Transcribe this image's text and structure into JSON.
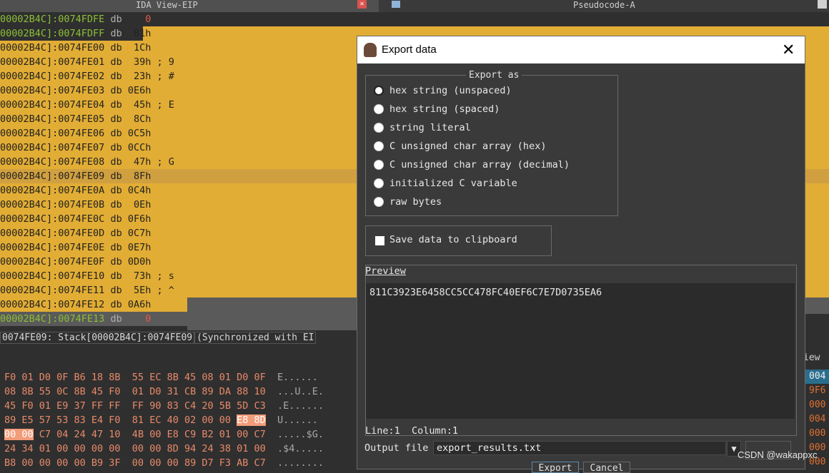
{
  "tabs": {
    "ida_view": "IDA View-EIP",
    "pseudocode": "Pseudocode-A"
  },
  "disasm": [
    {
      "addr": "00002B4C]:0074FDFE",
      "op": "db",
      "val": "   0",
      "cmt": "",
      "style": "dim"
    },
    {
      "addr": "00002B4C]:0074FDFF",
      "op": "db",
      "val": " 81h",
      "cmt": "",
      "style": "start"
    },
    {
      "addr": "00002B4C]:0074FE00",
      "op": "db",
      "val": " 1Ch",
      "cmt": "",
      "style": "sel"
    },
    {
      "addr": "00002B4C]:0074FE01",
      "op": "db",
      "val": " 39h",
      "cmt": " ; 9",
      "style": "sel"
    },
    {
      "addr": "00002B4C]:0074FE02",
      "op": "db",
      "val": " 23h",
      "cmt": " ; #",
      "style": "sel"
    },
    {
      "addr": "00002B4C]:0074FE03",
      "op": "db",
      "val": "0E6h",
      "cmt": "",
      "style": "sel"
    },
    {
      "addr": "00002B4C]:0074FE04",
      "op": "db",
      "val": " 45h",
      "cmt": " ; E",
      "style": "sel"
    },
    {
      "addr": "00002B4C]:0074FE05",
      "op": "db",
      "val": " 8Ch",
      "cmt": "",
      "style": "sel"
    },
    {
      "addr": "00002B4C]:0074FE06",
      "op": "db",
      "val": "0C5h",
      "cmt": "",
      "style": "sel"
    },
    {
      "addr": "00002B4C]:0074FE07",
      "op": "db",
      "val": "0CCh",
      "cmt": "",
      "style": "sel"
    },
    {
      "addr": "00002B4C]:0074FE08",
      "op": "db",
      "val": " 47h",
      "cmt": " ; G",
      "style": "sel"
    },
    {
      "addr": "00002B4C]:0074FE09",
      "op": "db",
      "val": " 8Fh",
      "cmt": "",
      "style": "cur"
    },
    {
      "addr": "00002B4C]:0074FE0A",
      "op": "db",
      "val": "0C4h",
      "cmt": "",
      "style": "sel"
    },
    {
      "addr": "00002B4C]:0074FE0B",
      "op": "db",
      "val": " 0Eh",
      "cmt": "",
      "style": "sel"
    },
    {
      "addr": "00002B4C]:0074FE0C",
      "op": "db",
      "val": "0F6h",
      "cmt": "",
      "style": "sel"
    },
    {
      "addr": "00002B4C]:0074FE0D",
      "op": "db",
      "val": "0C7h",
      "cmt": "",
      "style": "sel"
    },
    {
      "addr": "00002B4C]:0074FE0E",
      "op": "db",
      "val": "0E7h",
      "cmt": "",
      "style": "sel"
    },
    {
      "addr": "00002B4C]:0074FE0F",
      "op": "db",
      "val": "0D0h",
      "cmt": "",
      "style": "sel"
    },
    {
      "addr": "00002B4C]:0074FE10",
      "op": "db",
      "val": " 73h",
      "cmt": " ; s",
      "style": "sel"
    },
    {
      "addr": "00002B4C]:0074FE11",
      "op": "db",
      "val": " 5Eh",
      "cmt": " ; ^",
      "style": "sel"
    },
    {
      "addr": "00002B4C]:0074FE12",
      "op": "db",
      "val": "0A6h",
      "cmt": "",
      "style": "end"
    },
    {
      "addr": "00002B4C]:0074FE13",
      "op": "db",
      "val": "   0",
      "cmt": "",
      "style": "dim"
    }
  ],
  "status_line": {
    "location": "0074FE09: Stack[00002B4C]:0074FE09",
    "sync": "(Synchronized with EI"
  },
  "hex_rows": [
    {
      "bytes": "F0 01 D0 0F B6 18 8B  55 EC 8B 45 08 01 D0 0F",
      "ascii": "E......"
    },
    {
      "bytes": "08 8B 55 0C 8B 45 F0  01 D0 31 CB 89 DA 88 10",
      "ascii": "...U..E."
    },
    {
      "bytes": "45 F0 01 E9 37 FF FF  FF 90 83 C4 20 5B 5D C3",
      "ascii": ".E......"
    },
    {
      "bytes": "89 E5 57 53 83 E4 F0  81 EC 40 02 00 00 ",
      "sel_tail": "E8 8D",
      "ascii": "U......"
    },
    {
      "sel_head": "00 00",
      "bytes": " C7 04 24 47 10  4B 00 E8 C9 B2 01 00 C7",
      "ascii": ".....$G."
    },
    {
      "bytes": "24 34 01 00 00 00 00  00 00 8D 94 24 38 01 00",
      "ascii": ".$4....."
    },
    {
      "bytes": "B8 00 00 00 00 B9 3F  00 00 00 89 D7 F3 AB C7",
      "ascii": "........"
    }
  ],
  "right_pane": {
    "view_tail": "iew",
    "values": [
      "004",
      "9F6",
      "000",
      "004",
      "000",
      "000",
      "000"
    ]
  },
  "dialog": {
    "title": "Export data",
    "export_as_label": "Export as",
    "options": [
      {
        "label": "hex string (unspaced)",
        "selected": true
      },
      {
        "label": "hex string (spaced)",
        "selected": false
      },
      {
        "label": "string literal",
        "selected": false
      },
      {
        "label": "C unsigned char array (hex)",
        "selected": false
      },
      {
        "label": "C unsigned char array (decimal)",
        "selected": false
      },
      {
        "label": "initialized C variable",
        "selected": false
      },
      {
        "label": "raw bytes",
        "selected": false
      }
    ],
    "clipboard_label": "Save data to clipboard",
    "clipboard_checked": false,
    "preview_label": "Preview",
    "preview_text": "811C3923E6458CC5CC478FC40EF6C7E7D0735EA6",
    "cursor_pos": "Line:1  Column:1",
    "output_file_label": "Output file",
    "output_file_value": "export_results.txt",
    "browse_label": "...",
    "export_label": "Export",
    "cancel_label": "Cancel"
  },
  "watermark": "CSDN @wakappxc",
  "colors": {
    "selection": "#e2ad34",
    "address_dim": "#8cbf36",
    "hex_byte": "#e88a6a",
    "dialog_bg": "#3a3a3a"
  }
}
